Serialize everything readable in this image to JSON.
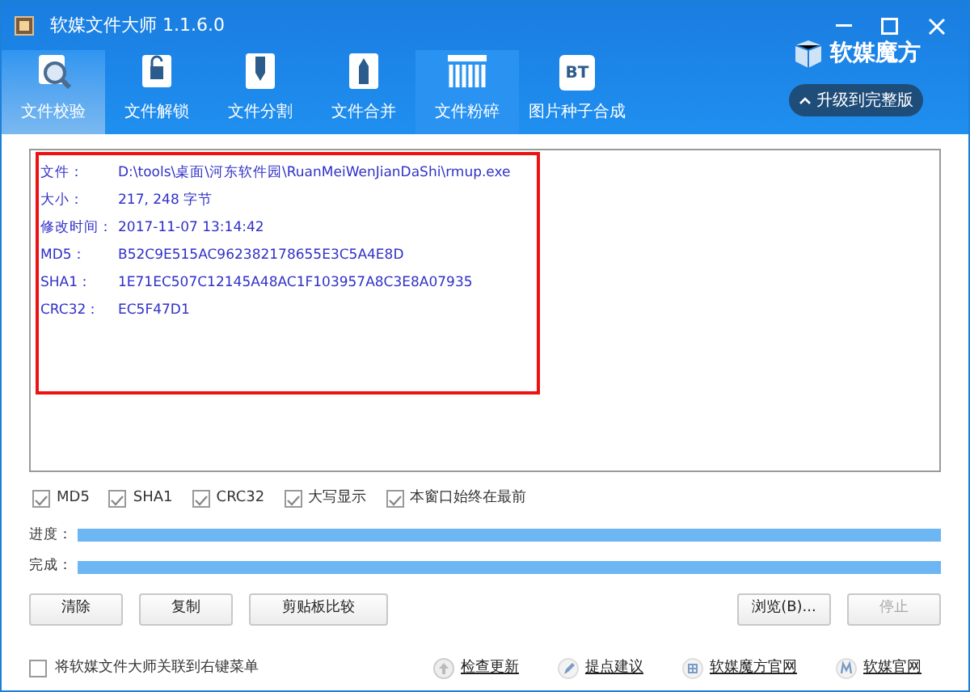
{
  "window": {
    "title": "软媒文件大师 1.1.6.0"
  },
  "tabs": [
    {
      "label": "文件校验",
      "selected": true,
      "hovered": false,
      "kind": "magnifier"
    },
    {
      "label": "文件解锁",
      "selected": false,
      "hovered": false,
      "kind": "lock"
    },
    {
      "label": "文件分割",
      "selected": false,
      "hovered": false,
      "kind": "split"
    },
    {
      "label": "文件合并",
      "selected": false,
      "hovered": false,
      "kind": "merge"
    },
    {
      "label": "文件粉碎",
      "selected": false,
      "hovered": true,
      "kind": "shredder"
    },
    {
      "label": "图片种子合成",
      "selected": false,
      "hovered": false,
      "kind": "badge",
      "icon_text": "BT"
    }
  ],
  "brand": {
    "name": "软媒魔方",
    "upgrade_button": "升级到完整版"
  },
  "results": [
    {
      "label": "文件：",
      "value": "D:\\tools\\桌面\\河东软件园\\RuanMeiWenJianDaShi\\rmup.exe"
    },
    {
      "label": "大小：",
      "value": "217, 248 字节"
    },
    {
      "label": "修改时间：",
      "value": "2017-11-07 13:14:42"
    },
    {
      "label": "MD5：",
      "value": "B52C9E515AC962382178655E3C5A4E8D"
    },
    {
      "label": "SHA1：",
      "value": "1E71EC507C12145A48AC1F103957A8C3E8A07935"
    },
    {
      "label": "CRC32：",
      "value": "EC5F47D1"
    }
  ],
  "options": [
    {
      "label": "MD5",
      "checked": true
    },
    {
      "label": "SHA1",
      "checked": true
    },
    {
      "label": "CRC32",
      "checked": true
    },
    {
      "label": "大写显示",
      "checked": true
    },
    {
      "label": "本窗口始终在最前",
      "checked": true
    }
  ],
  "progress": [
    {
      "label": "进度：",
      "level": 1
    },
    {
      "label": "完成：",
      "level": 1
    }
  ],
  "buttons_left": [
    {
      "label": "清除",
      "disabled": false
    },
    {
      "label": "复制",
      "disabled": false
    },
    {
      "label": "剪贴板比较",
      "disabled": false
    }
  ],
  "buttons_right": [
    {
      "label": "浏览(B)...",
      "disabled": false
    },
    {
      "label": "停止",
      "disabled": true
    }
  ],
  "footer": {
    "context_menu_option": {
      "label": "将软媒文件大师关联到右键菜单",
      "checked": false
    },
    "links": [
      {
        "label": "检查更新",
        "kind": "update"
      },
      {
        "label": "提点建议",
        "kind": "feedback"
      },
      {
        "label": "软媒魔方官网",
        "kind": "cube"
      },
      {
        "label": "软媒官网",
        "kind": "home"
      }
    ]
  }
}
